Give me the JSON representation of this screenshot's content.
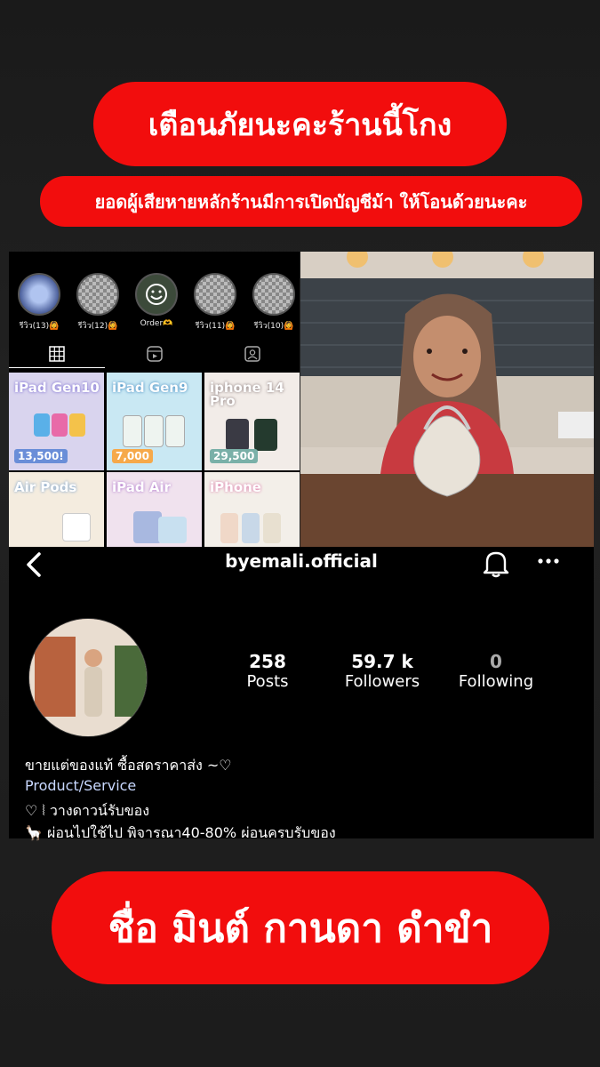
{
  "banner_top": "เตือนภัยนะคะร้านนี้โกง",
  "banner_sub": "ยอดผู้เสียหายหลักร้านมีการเปิดบัญชีม้า ให้โอนด้วยนะคะ",
  "banner_bottom": "ชื่อ มินต์ กานดา ดำขำ",
  "highlights": [
    {
      "label": "รีวิว(13)🙆",
      "icon": "avatar-photo"
    },
    {
      "label": "รีวิว(12)🙆",
      "icon": "placeholder-checker"
    },
    {
      "label": "Order🫶",
      "icon": "smile-photo"
    },
    {
      "label": "รีวิว(11)🙆",
      "icon": "placeholder-checker"
    },
    {
      "label": "รีวิว(10)🙆",
      "icon": "placeholder-checker"
    }
  ],
  "tabs": [
    "grid-icon",
    "reels-icon",
    "tagged-icon"
  ],
  "posts": [
    {
      "title": "iPad Gen10",
      "price": "13,500!",
      "color": "#d9d4ee"
    },
    {
      "title": "iPad Gen9",
      "price": "7,000",
      "color": "#c9e8f3"
    },
    {
      "title": "iphone 14 Pro",
      "price": "29,500",
      "color": "#f2ece8"
    },
    {
      "title": "Air Pods",
      "price": "",
      "color": "#f4ecdf"
    },
    {
      "title": "iPad Air",
      "price": "",
      "color": "#f0e2ee"
    },
    {
      "title": "iPhone",
      "price": "",
      "color": "#f3efe9"
    }
  ],
  "profile": {
    "handle": "byemali.official",
    "posts_count": "258",
    "posts_label": "Posts",
    "followers_count": "59.7 k",
    "followers_label": "Followers",
    "following_count": "0",
    "following_label": "Following",
    "bio_line1": "ขายแต่ของแท้ ซื้อสดราคาส่ง ~♡",
    "category": "Product/Service",
    "bio_line2": "♡ ⦚ วางดาวน์รับของ",
    "bio_line3": "🦙 ผ่อนไปใช้ไป พิจารณา40-80% ผ่อนครบรับของ"
  },
  "colors": {
    "banner": "#f20d0d",
    "category": "#c8d8ff"
  }
}
